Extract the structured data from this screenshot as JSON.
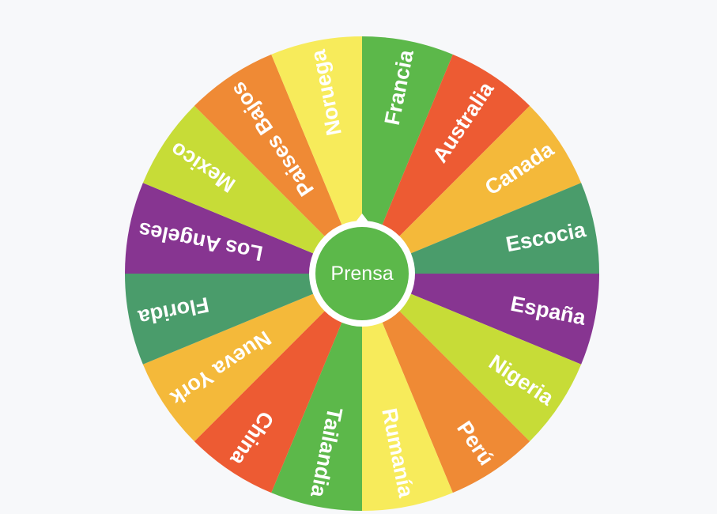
{
  "wheel": {
    "center_label": "Prensa",
    "segments": [
      {
        "label": "Francia",
        "color": "#5cb84a"
      },
      {
        "label": "Australia",
        "color": "#ed5b33"
      },
      {
        "label": "Canada",
        "color": "#f4b93a"
      },
      {
        "label": "Escocia",
        "color": "#4a9c6b"
      },
      {
        "label": "España",
        "color": "#873591"
      },
      {
        "label": "Nigeria",
        "color": "#c7dc37"
      },
      {
        "label": "Perú",
        "color": "#ef8a35"
      },
      {
        "label": "Rumanía",
        "color": "#f7eb5b"
      },
      {
        "label": "Tailandia",
        "color": "#5cb84a"
      },
      {
        "label": "China",
        "color": "#ed5b33"
      },
      {
        "label": "Nueva York",
        "color": "#f4b93a"
      },
      {
        "label": "Florida",
        "color": "#4a9c6b"
      },
      {
        "label": "Los Angeles",
        "color": "#873591"
      },
      {
        "label": "Mexico",
        "color": "#c7dc37"
      },
      {
        "label": "Paises Bajos",
        "color": "#ef8a35"
      },
      {
        "label": "Noruega",
        "color": "#f7eb5b"
      }
    ],
    "hub_color": "#5cb84a",
    "hub_ring_color": "#ffffff"
  }
}
